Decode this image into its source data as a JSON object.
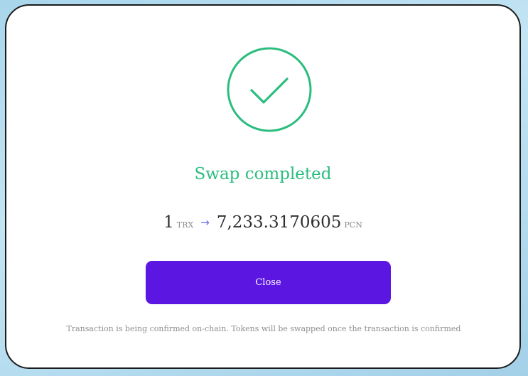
{
  "modal": {
    "title": "Swap completed",
    "from_amount": "1",
    "from_token": "TRX",
    "to_amount": "7,233.3170605",
    "to_token": "PCN",
    "close_label": "Close",
    "note": "Transaction is being confirmed on-chain. Tokens will be swapped once the transaction is confirmed"
  },
  "icons": {
    "status": "check-circle-icon",
    "arrow": "arrow-right-icon"
  },
  "colors": {
    "success": "#2bbd7e",
    "primary_button": "#5b16e2",
    "arrow": "#5b6cf2"
  }
}
